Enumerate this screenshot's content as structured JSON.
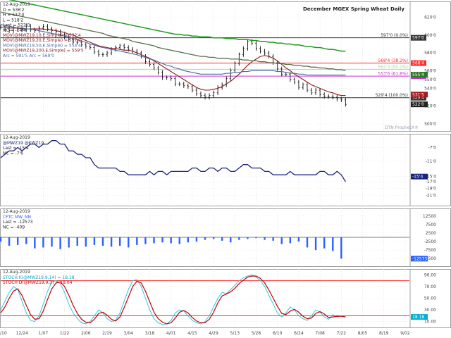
{
  "chart_data": [
    {
      "type": "line",
      "title": "December MGEX Spring Wheat Daily",
      "watermark": "DTN ProphetX®",
      "date_label": "12-Aug-2019",
      "legend": [
        "O = 536'2",
        "H = 537'0",
        "L = 518'2",
        "Last = 522'0",
        "NC = -14'4",
        "MOV(@MWZ19,10,E,Simple) = 532'4",
        "MOV(@MWZ19,20,E,Simple) = 537'0",
        "MOV(@MWZ19,50,E,Simple) = 554'4",
        "MOV(@MWZ19,200,E,Simple) = 559'5",
        "Arc = 591'5 Arc = 569'0"
      ],
      "y_ticks": [
        "620'0",
        "600'0",
        "580'0",
        "560'0",
        "550'0",
        "540'0",
        "520'0",
        "500'0"
      ],
      "y_tick_values": [
        620,
        600,
        580,
        560,
        550,
        540,
        520,
        500
      ],
      "y_range": [
        492,
        638
      ],
      "hlines": [
        {
          "label": "597'0 (0.0%)",
          "value": 597,
          "color": "#333333",
          "tag": "597'0"
        },
        {
          "label": "568'4 (38.2%)",
          "value": 568.5,
          "color": "#ff2a2a",
          "tag": "568'4"
        },
        {
          "label": "561'3 (50.0%)",
          "value": 561.5,
          "color": "#a8d8a0"
        },
        {
          "label": "553'6 (61.8%)",
          "value": 553.75,
          "color": "#cc33cc",
          "tag": "553'6"
        },
        {
          "label": "529'4 (100.0%)",
          "value": 529.5,
          "color": "#333333",
          "tag": "529'4"
        }
      ],
      "right_tags": [
        {
          "text": "555'4",
          "value": 555.5,
          "color": "#2a7a2a"
        },
        {
          "text": "531'5",
          "value": 533,
          "color": "#aa1a1a"
        },
        {
          "text": "522'0",
          "value": 522,
          "color": "#222222"
        }
      ],
      "series": [
        {
          "name": "Price",
          "values": [
            609,
            607,
            605,
            608,
            607,
            606,
            610,
            606,
            605,
            608,
            610,
            607,
            605,
            604,
            601,
            598,
            595,
            592,
            592,
            589,
            587,
            586,
            581,
            578,
            578,
            580,
            584,
            586,
            588,
            586,
            584,
            582,
            580,
            576,
            570,
            567,
            563,
            558,
            552,
            552,
            551,
            545,
            545,
            543,
            542,
            538,
            534,
            532,
            530,
            532,
            535,
            541,
            544,
            551,
            560,
            568,
            578,
            585,
            593,
            591,
            585,
            582,
            580,
            576,
            569,
            562,
            556,
            556,
            550,
            547,
            541,
            544,
            538,
            535,
            538,
            533,
            531,
            531,
            530,
            528,
            527,
            522
          ]
        },
        {
          "name": "MA 20",
          "values": [
            609,
            609,
            608,
            608,
            608,
            607,
            607,
            607,
            607,
            607,
            607,
            606,
            606,
            605,
            604,
            603,
            601,
            600,
            598,
            596,
            594,
            592,
            590,
            588,
            587,
            586,
            585,
            585,
            584,
            583,
            583,
            582,
            580,
            578,
            576,
            574,
            571,
            568,
            565,
            562,
            559,
            556,
            553,
            550,
            547,
            544,
            541,
            539,
            538,
            538,
            539,
            540,
            542,
            545,
            548,
            552,
            556,
            561,
            566,
            570,
            573,
            576,
            577,
            576,
            574,
            571,
            567,
            563,
            560,
            556,
            553,
            550,
            547,
            544,
            542,
            540,
            538,
            536,
            535,
            533,
            532,
            532
          ]
        },
        {
          "name": "MA 50",
          "values": [
            612,
            611,
            610,
            609,
            608,
            608,
            607,
            607,
            606,
            605,
            604,
            603,
            602,
            601,
            600,
            599,
            598,
            596,
            595,
            593,
            592,
            590,
            589,
            587,
            586,
            585,
            584,
            583,
            582,
            581,
            580,
            579,
            578,
            576,
            575,
            573,
            572,
            570,
            568,
            566,
            565,
            563,
            562,
            560,
            559,
            558,
            557,
            556,
            556,
            556,
            556,
            556,
            556,
            557,
            557,
            558,
            558,
            559,
            559,
            560,
            560,
            560,
            560,
            560,
            560,
            559,
            559,
            558,
            557,
            557,
            556,
            556,
            555,
            555,
            555,
            555,
            555,
            555,
            555,
            555,
            555,
            555
          ]
        },
        {
          "name": "MA 100",
          "values": [
            626,
            625,
            624,
            623,
            622,
            621,
            620,
            619,
            618,
            617,
            616,
            615,
            614,
            613,
            612,
            611,
            610,
            609,
            608,
            607,
            606,
            605,
            604,
            603,
            602,
            600,
            599,
            598,
            597,
            596,
            595,
            593,
            592,
            591,
            590,
            589,
            588,
            586,
            585,
            584,
            583,
            582,
            581,
            580,
            579,
            578,
            577,
            576,
            576,
            575,
            575,
            574,
            574,
            574,
            573,
            573,
            573,
            572,
            572,
            571,
            571,
            570,
            570,
            569,
            569,
            568,
            568,
            567,
            567,
            566,
            566,
            565,
            565,
            564,
            564,
            563,
            563,
            562,
            562,
            561,
            561,
            560
          ]
        },
        {
          "name": "MA 200",
          "values": [
            642,
            641,
            640,
            639,
            638,
            637,
            636,
            635,
            634,
            633,
            632,
            631,
            630,
            629,
            628,
            627,
            626,
            625,
            624,
            623,
            622,
            621,
            620,
            619,
            618,
            617,
            616,
            615,
            614,
            613,
            612,
            611,
            610,
            609,
            608,
            607,
            606,
            605,
            604,
            603,
            602,
            601,
            601,
            600,
            600,
            599,
            599,
            598,
            598,
            598,
            597,
            597,
            597,
            596,
            596,
            596,
            595,
            595,
            595,
            594,
            594,
            593,
            593,
            592,
            592,
            591,
            591,
            590,
            590,
            589,
            589,
            588,
            587,
            587,
            586,
            586,
            585,
            584,
            584,
            583,
            582,
            582
          ]
        }
      ]
    },
    {
      "type": "line",
      "date_label": "12-Aug-2019",
      "legend": [
        "@MWZ19 @KWZ19",
        "Last = -15'4",
        "NC = -7'6"
      ],
      "y_ticks": [
        "-7'0",
        "-11'0",
        "-15'4",
        "-17'0",
        "-19'0",
        "-21'0"
      ],
      "y_tick_values": [
        -7,
        -11,
        -15.5,
        -17,
        -19,
        -21
      ],
      "y_range": [
        -24,
        -3
      ],
      "right_tags": [
        {
          "text": "-15'4",
          "value": -15.5,
          "color": "#1a237e"
        }
      ],
      "series": [
        {
          "name": "Spread",
          "values": [
            -10,
            -9,
            -8,
            -8,
            -7,
            -8,
            -7,
            -6,
            -6,
            -7,
            -6,
            -6,
            -5,
            -5,
            -6,
            -6,
            -8,
            -8,
            -9,
            -9,
            -10,
            -10,
            -12,
            -13,
            -13,
            -13,
            -13,
            -13,
            -14,
            -14,
            -15,
            -15,
            -15,
            -15,
            -15,
            -14,
            -15,
            -14,
            -14,
            -15,
            -14,
            -14,
            -14,
            -14,
            -14,
            -13,
            -13,
            -14,
            -14,
            -13,
            -13,
            -14,
            -13,
            -13,
            -14,
            -14,
            -13,
            -12,
            -12,
            -13,
            -13,
            -13,
            -14,
            -14,
            -15,
            -15,
            -15,
            -15,
            -14,
            -15,
            -15,
            -15,
            -15,
            -15,
            -15,
            -14,
            -14,
            -15,
            -15,
            -14,
            -15,
            -17
          ]
        }
      ]
    },
    {
      "type": "bar",
      "date_label": "12-Aug-2019",
      "legend": [
        "CFTC MW_NN",
        "Last = -12573",
        "NC = -409"
      ],
      "y_ticks": [
        "12500",
        "7500",
        "2500",
        "-2500",
        "-7500",
        "-12500"
      ],
      "y_tick_values": [
        12500,
        7500,
        2500,
        -2500,
        -7500,
        -12500
      ],
      "y_range": [
        -17000,
        17000
      ],
      "zero_line": 0,
      "right_tags": [
        {
          "text": "-12573",
          "value": -12573,
          "color": "#2962ff"
        }
      ],
      "series": [
        {
          "name": "CFTC MW_NN",
          "x": [
            0,
            2,
            4,
            6,
            8,
            10,
            12,
            14,
            16,
            18,
            20,
            22,
            24,
            26,
            28,
            30,
            32,
            34,
            36,
            38,
            40,
            42,
            44,
            46,
            48,
            50,
            52,
            54,
            56,
            58,
            60,
            62,
            64,
            66,
            68,
            70,
            72,
            74,
            76,
            78,
            80
          ],
          "values": [
            -2500,
            -5000,
            -4500,
            -4000,
            -6500,
            -6000,
            -5500,
            -7000,
            -6000,
            -5000,
            -5500,
            -4500,
            -5000,
            -5500,
            -5000,
            -6000,
            -4500,
            -4000,
            -3500,
            -3000,
            -3500,
            -4000,
            -3000,
            -2500,
            -1500,
            -1000,
            -2000,
            -3000,
            -1500,
            -1000,
            -500,
            -1500,
            -2000,
            -4000,
            -3500,
            -2500,
            -6000,
            -7500,
            -6500,
            -8000,
            -12573
          ]
        }
      ]
    },
    {
      "type": "line",
      "date_label": "12-Aug-2019",
      "legend": [
        "STOCH K(@MWZ19,9,14) = 18.18",
        "STOCH D(@MWZ19,9,3) = 18.04"
      ],
      "y_ticks": [
        "90.00",
        "70.00",
        "50.00",
        "30.00",
        "10.00"
      ],
      "y_tick_values": [
        90,
        70,
        50,
        30,
        10
      ],
      "y_range": [
        0,
        100
      ],
      "hlines": [
        {
          "label": "",
          "value": 80,
          "color": "#ff2a2a"
        },
        {
          "label": "",
          "value": 20,
          "color": "#ff2a2a"
        }
      ],
      "right_tags": [
        {
          "text": "18.18",
          "value": 18,
          "color": "#00b0d0"
        }
      ],
      "series": [
        {
          "name": "Stoch K",
          "values": [
            30,
            45,
            60,
            70,
            65,
            45,
            25,
            12,
            10,
            20,
            40,
            62,
            78,
            80,
            75,
            60,
            40,
            25,
            15,
            8,
            6,
            10,
            20,
            30,
            25,
            15,
            10,
            12,
            25,
            45,
            65,
            80,
            82,
            70,
            50,
            30,
            15,
            8,
            5,
            6,
            12,
            25,
            30,
            28,
            20,
            12,
            8,
            6,
            10,
            20,
            35,
            50,
            60,
            58,
            65,
            72,
            80,
            85,
            88,
            90,
            86,
            80,
            70,
            55,
            40,
            25,
            18,
            25,
            35,
            30,
            20,
            15,
            12,
            20,
            30,
            26,
            18,
            14,
            22,
            18,
            20,
            18
          ]
        },
        {
          "name": "Stoch D",
          "values": [
            25,
            35,
            50,
            62,
            66,
            55,
            38,
            22,
            14,
            15,
            28,
            48,
            66,
            76,
            78,
            70,
            55,
            38,
            24,
            14,
            9,
            8,
            14,
            24,
            26,
            21,
            14,
            11,
            18,
            34,
            52,
            70,
            79,
            76,
            62,
            44,
            26,
            15,
            9,
            6,
            8,
            16,
            26,
            29,
            25,
            17,
            11,
            8,
            8,
            14,
            26,
            42,
            54,
            57,
            61,
            67,
            75,
            81,
            86,
            88,
            88,
            84,
            76,
            64,
            50,
            36,
            24,
            22,
            28,
            31,
            26,
            19,
            15,
            16,
            24,
            27,
            23,
            17,
            18,
            19,
            19,
            18
          ]
        }
      ]
    }
  ],
  "x_axis": {
    "labels": [
      "12/10",
      "12/24",
      "1/07",
      "1/22",
      "2/06",
      "2/19",
      "3/04",
      "3/18",
      "4/01",
      "4/15",
      "4/29",
      "5/13",
      "5/28",
      "6/10",
      "6/24",
      "7/08",
      "7/22",
      "8/05",
      "8/19",
      "9/02"
    ],
    "positions": [
      0,
      5,
      10,
      15,
      20,
      25,
      30,
      35,
      40,
      45,
      50,
      55,
      60,
      65,
      70,
      75,
      80,
      85,
      90,
      95
    ]
  }
}
